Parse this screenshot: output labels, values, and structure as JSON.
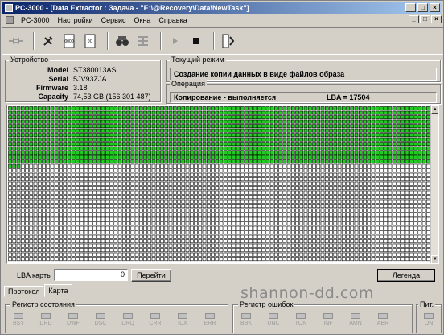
{
  "window": {
    "title": "PC-3000 - [Data Extractor : Задача - \"E:\\@Recovery\\Data\\NewTask\"]",
    "minimize": "_",
    "maximize": "□",
    "close": "×"
  },
  "menu": {
    "items": [
      "PC-3000",
      "Настройки",
      "Сервис",
      "Окна",
      "Справка"
    ],
    "mdi_minimize": "_",
    "mdi_restore": "□",
    "mdi_close": "×"
  },
  "toolbar": {
    "icons": [
      "connector-icon",
      "tools-icon",
      "sector-map-icon",
      "sector-tab-icon",
      "find-icon",
      "stack-icon",
      "play-icon",
      "stop-icon",
      "exit-icon"
    ]
  },
  "device": {
    "title": "Устройство",
    "model_label": "Model",
    "model": "ST380013AS",
    "serial_label": "Serial",
    "serial": "5JV93ZJA",
    "firmware_label": "Firmware",
    "firmware": "3.18",
    "capacity_label": "Capacity",
    "capacity": "74,53 GB (156 301 487)"
  },
  "mode": {
    "title": "Текущий режим",
    "text": "Создание копии данных в виде файлов образа"
  },
  "operation": {
    "title": "Операция",
    "text": "Копирование - выполняется",
    "lba": "LBA = 17504"
  },
  "map": {
    "columns": 100,
    "rows": 35,
    "filled_full_rows": 13,
    "filled_partial": 3,
    "colors": {
      "done": "#22cc22",
      "pending": "#ffffff",
      "border": "#000000"
    }
  },
  "lba_nav": {
    "label": "LBA карты",
    "value": "0",
    "go_button": "Перейти",
    "legend_button": "Легенда"
  },
  "tabs": [
    "Протокол",
    "Карта"
  ],
  "status_register": {
    "title": "Регистр состояния",
    "bits": [
      "BSY",
      "DRD",
      "DWF",
      "DSC",
      "DRQ",
      "CRR",
      "IDX",
      "ERR"
    ]
  },
  "error_register": {
    "title": "Регистр ошибок",
    "bits": [
      "BBK",
      "UNC",
      "INF",
      "ABR",
      "TON",
      "AMN"
    ]
  },
  "power": {
    "title": "Пит.",
    "bits": [
      "ON"
    ]
  },
  "watermark": "shannon-dd.com"
}
